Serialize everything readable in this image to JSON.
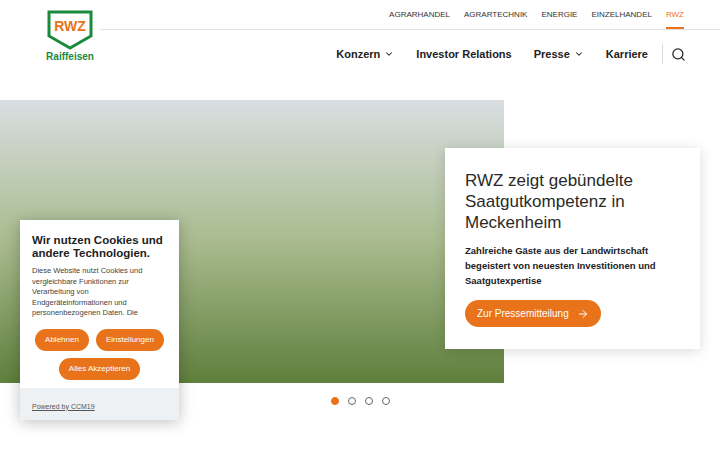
{
  "logo": {
    "mark": "RWZ",
    "name": "Raiffeisen"
  },
  "top_links": [
    {
      "label": "AGRARHANDEL",
      "selected": false
    },
    {
      "label": "AGRARTECHNIK",
      "selected": false
    },
    {
      "label": "ENERGIE",
      "selected": false
    },
    {
      "label": "EINZELHANDEL",
      "selected": false
    },
    {
      "label": "RWZ",
      "selected": true
    }
  ],
  "nav": [
    {
      "label": "Konzern",
      "has_dropdown": true
    },
    {
      "label": "Investor Relations",
      "has_dropdown": false
    },
    {
      "label": "Presse",
      "has_dropdown": true
    },
    {
      "label": "Karriere",
      "has_dropdown": false
    }
  ],
  "hero": {
    "title": "RWZ zeigt gebündelte Saatgutkompetenz in Meckenheim",
    "subtitle": "Zahlreiche Gäste aus der Landwirtschaft begeistert von neuesten Investitionen und Saatgutexpertise",
    "button": "Zur Pressemitteilung"
  },
  "slider_dots": [
    {
      "selected": true
    },
    {
      "selected": false
    },
    {
      "selected": false
    },
    {
      "selected": false
    }
  ],
  "cookie_banner": {
    "title": "Wir nutzen Cookies und andere Technologien.",
    "text": "Diese Website nutzt Cookies und vergleichbare Funktionen zur Verarbeitung von Endgeräteinformationen und personenbezogenen Daten. Die",
    "buttons": [
      "Ablehnen",
      "Einstellungen",
      "Alles Akzeptieren"
    ],
    "powered_by": "Powered by CCM19"
  }
}
